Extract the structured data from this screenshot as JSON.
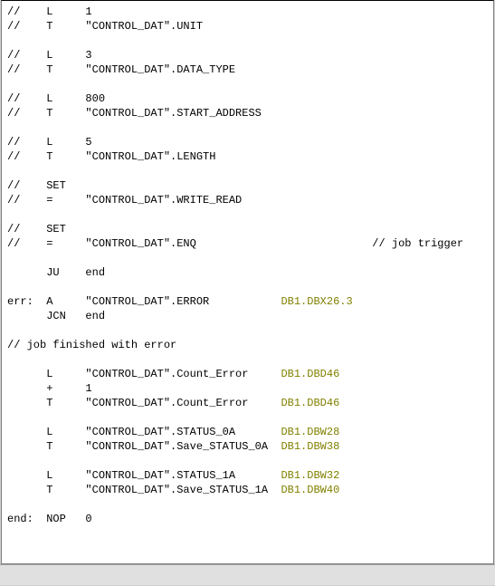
{
  "lines": [
    {
      "prefix": "//",
      "label": "",
      "op": "L",
      "arg": "1",
      "addr": "",
      "comment": ""
    },
    {
      "prefix": "//",
      "label": "",
      "op": "T",
      "arg": "\"CONTROL_DAT\".UNIT",
      "addr": "",
      "comment": ""
    },
    {
      "blank": true
    },
    {
      "prefix": "//",
      "label": "",
      "op": "L",
      "arg": "3",
      "addr": "",
      "comment": ""
    },
    {
      "prefix": "//",
      "label": "",
      "op": "T",
      "arg": "\"CONTROL_DAT\".DATA_TYPE",
      "addr": "",
      "comment": ""
    },
    {
      "blank": true
    },
    {
      "prefix": "//",
      "label": "",
      "op": "L",
      "arg": "800",
      "addr": "",
      "comment": ""
    },
    {
      "prefix": "//",
      "label": "",
      "op": "T",
      "arg": "\"CONTROL_DAT\".START_ADDRESS",
      "addr": "",
      "comment": ""
    },
    {
      "blank": true
    },
    {
      "prefix": "//",
      "label": "",
      "op": "L",
      "arg": "5",
      "addr": "",
      "comment": ""
    },
    {
      "prefix": "//",
      "label": "",
      "op": "T",
      "arg": "\"CONTROL_DAT\".LENGTH",
      "addr": "",
      "comment": ""
    },
    {
      "blank": true
    },
    {
      "prefix": "//",
      "label": "",
      "op": "SET",
      "arg": "",
      "addr": "",
      "comment": ""
    },
    {
      "prefix": "//",
      "label": "",
      "op": "=",
      "arg": "\"CONTROL_DAT\".WRITE_READ",
      "addr": "",
      "comment": ""
    },
    {
      "blank": true
    },
    {
      "prefix": "//",
      "label": "",
      "op": "SET",
      "arg": "",
      "addr": "",
      "comment": ""
    },
    {
      "prefix": "//",
      "label": "",
      "op": "=",
      "arg": "\"CONTROL_DAT\".ENQ",
      "addr": "",
      "comment": "// job trigger"
    },
    {
      "blank": true
    },
    {
      "prefix": "",
      "label": "",
      "op": "JU",
      "arg": "end",
      "addr": "",
      "comment": ""
    },
    {
      "blank": true
    },
    {
      "prefix": "",
      "label": "err:",
      "op": "A",
      "arg": "\"CONTROL_DAT\".ERROR",
      "addr": "DB1.DBX26.3",
      "comment": ""
    },
    {
      "prefix": "",
      "label": "",
      "op": "JCN",
      "arg": "end",
      "addr": "",
      "comment": ""
    },
    {
      "blank": true
    },
    {
      "raw": "// job finished with error"
    },
    {
      "blank": true
    },
    {
      "prefix": "",
      "label": "",
      "op": "L",
      "arg": "\"CONTROL_DAT\".Count_Error",
      "addr": "DB1.DBD46",
      "comment": ""
    },
    {
      "prefix": "",
      "label": "",
      "op": "+",
      "arg": "1",
      "addr": "",
      "comment": ""
    },
    {
      "prefix": "",
      "label": "",
      "op": "T",
      "arg": "\"CONTROL_DAT\".Count_Error",
      "addr": "DB1.DBD46",
      "comment": ""
    },
    {
      "blank": true
    },
    {
      "prefix": "",
      "label": "",
      "op": "L",
      "arg": "\"CONTROL_DAT\".STATUS_0A",
      "addr": "DB1.DBW28",
      "comment": ""
    },
    {
      "prefix": "",
      "label": "",
      "op": "T",
      "arg": "\"CONTROL_DAT\".Save_STATUS_0A",
      "addr": "DB1.DBW38",
      "comment": ""
    },
    {
      "blank": true
    },
    {
      "prefix": "",
      "label": "",
      "op": "L",
      "arg": "\"CONTROL_DAT\".STATUS_1A",
      "addr": "DB1.DBW32",
      "comment": ""
    },
    {
      "prefix": "",
      "label": "",
      "op": "T",
      "arg": "\"CONTROL_DAT\".Save_STATUS_1A",
      "addr": "DB1.DBW40",
      "comment": ""
    },
    {
      "blank": true
    },
    {
      "prefix": "",
      "label": "end:",
      "op": "NOP",
      "arg": "0",
      "addr": "",
      "comment": ""
    }
  ],
  "cols": {
    "labelCol": 6,
    "opCol": 6,
    "argCol": 30,
    "addrCol": 14
  }
}
